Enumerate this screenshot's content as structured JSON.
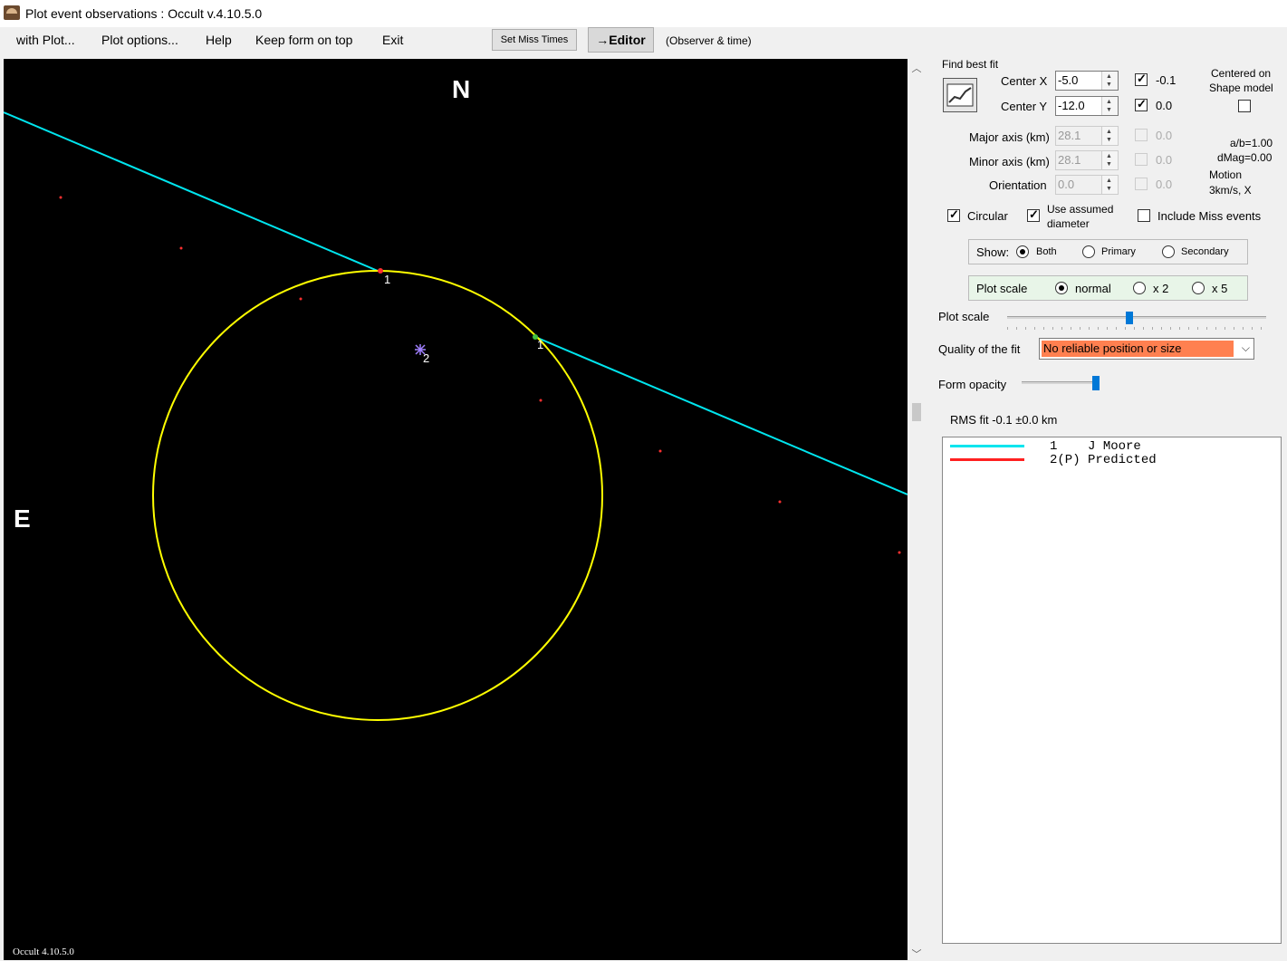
{
  "window": {
    "title": "Plot event observations : Occult v.4.10.5.0"
  },
  "menu": {
    "with_plot": "with Plot...",
    "plot_options": "Plot options...",
    "help": "Help",
    "keep_on_top": "Keep form on top",
    "exit": "Exit",
    "set_miss_times": "Set Miss Times",
    "editor": "→Editor",
    "observer_time": "(Observer & time)"
  },
  "plot": {
    "north": "N",
    "east": "E",
    "version": "Occult 4.10.5.0",
    "chord_label_1": "1",
    "chord_label_2": "1",
    "center_label": "2",
    "colors": {
      "background": "#000000",
      "chord": "#00e5ee",
      "ellipse": "#ffff00",
      "dots": "#ff3030"
    }
  },
  "panel": {
    "find_best_fit": "Find best fit",
    "center_x_label": "Center X",
    "center_x_value": "-5.0",
    "center_x_check": true,
    "center_x_check_label": "-0.1",
    "center_y_label": "Center Y",
    "center_y_value": "-12.0",
    "center_y_check": true,
    "center_y_check_label": "0.0",
    "centered_on_shape_line1": "Centered on",
    "centered_on_shape_line2": "Shape model",
    "centered_on_shape_checked": false,
    "major_axis_label": "Major axis (km)",
    "major_axis_value": "28.1",
    "major_axis_check_label": "0.0",
    "minor_axis_label": "Minor axis (km)",
    "minor_axis_value": "28.1",
    "minor_axis_check_label": "0.0",
    "orientation_label": "Orientation",
    "orientation_value": "0.0",
    "orientation_check_label": "0.0",
    "ab_ratio": "a/b=1.00",
    "dmag": "dMag=0.00",
    "motion": "Motion",
    "motion_value": "3km/s, X",
    "circular_label": "Circular",
    "circular_checked": true,
    "use_assumed_line1": "Use assumed",
    "use_assumed_line2": "diameter",
    "use_assumed_checked": true,
    "include_miss_label": "Include Miss events",
    "include_miss_checked": false,
    "show_label": "Show:",
    "show_options": [
      "Both",
      "Primary",
      "Secondary"
    ],
    "show_selected": "Both",
    "plot_scale_group_label": "Plot scale",
    "plot_scale_options": [
      "normal",
      "x 2",
      "x 5"
    ],
    "plot_scale_selected": "normal",
    "plot_scale_slider_label": "Plot scale",
    "plot_scale_slider_fraction": 0.47,
    "quality_label": "Quality of the fit",
    "quality_value": "No reliable position or size",
    "quality_color": "#ff8050",
    "form_opacity_label": "Form opacity",
    "form_opacity_fraction": 1.0,
    "rms_fit": "RMS fit -0.1 ±0.0 km"
  },
  "legend": [
    {
      "num": "1",
      "name": "J Moore",
      "color": "#00e5ee"
    },
    {
      "num": "2(P)",
      "name": "Predicted",
      "color": "#ff2020"
    }
  ]
}
